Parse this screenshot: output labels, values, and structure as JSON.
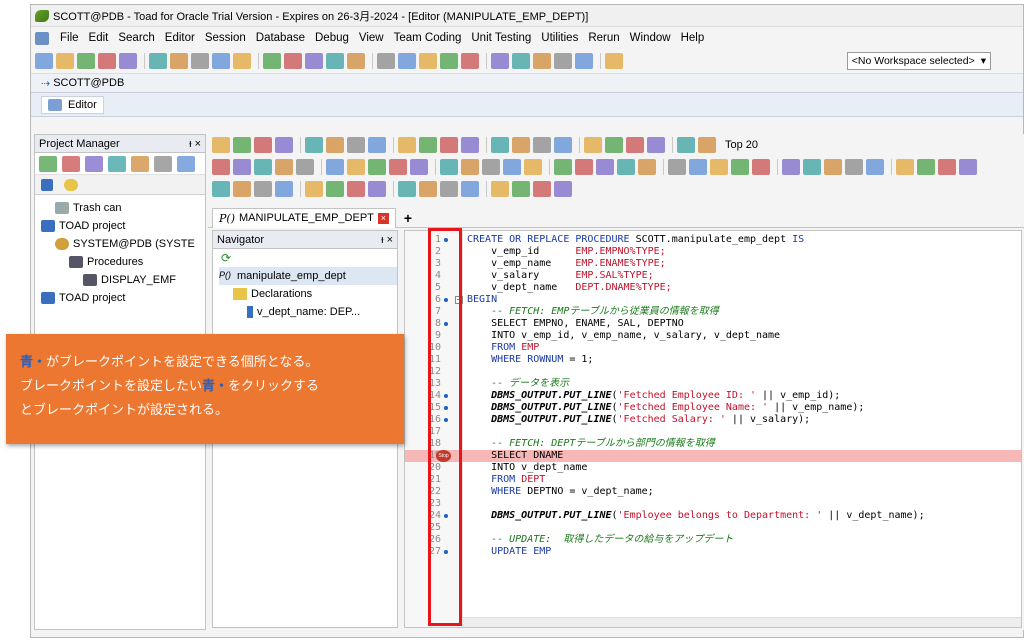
{
  "window": {
    "title": "SCOTT@PDB - Toad for Oracle Trial Version - Expires on 26-3月-2024 - [Editor (MANIPULATE_EMP_DEPT)]"
  },
  "menu": [
    "File",
    "Edit",
    "Search",
    "Editor",
    "Session",
    "Database",
    "Debug",
    "View",
    "Team Coding",
    "Unit Testing",
    "Utilities",
    "Rerun",
    "Window",
    "Help"
  ],
  "workspace": {
    "label": "<No Workspace selected>"
  },
  "connection_tab": {
    "label": "SCOTT@PDB"
  },
  "editor_tab": {
    "label": "Editor"
  },
  "project_manager": {
    "title": "Project Manager",
    "pin": "ᵼ ×",
    "tree": [
      {
        "label": "Trash can",
        "indent": 1,
        "icon": "trash"
      },
      {
        "label": "TOAD project",
        "indent": 0,
        "icon": "project"
      },
      {
        "label": "SYSTEM@PDB (SYSTE",
        "indent": 1,
        "icon": "db"
      },
      {
        "label": "Procedures",
        "indent": 2,
        "icon": "proc"
      },
      {
        "label": "DISPLAY_EMF",
        "indent": 3,
        "icon": "proc"
      },
      {
        "label": "TOAD project",
        "indent": 0,
        "icon": "project"
      }
    ]
  },
  "top_toolbar": {
    "top20": "Top 20"
  },
  "doc_tab": {
    "label": "MANIPULATE_EMP_DEPT",
    "close": "×",
    "add": "+"
  },
  "navigator": {
    "title": "Navigator",
    "pin": "ᵼ ×",
    "items": [
      {
        "label": "manipulate_emp_dept"
      },
      {
        "label": "Declarations"
      },
      {
        "label": "v_dept_name: DEP..."
      }
    ]
  },
  "code": [
    {
      "n": "1",
      "mark": "dot",
      "parts": [
        [
          "kw",
          "CREATE OR REPLACE PROCEDURE "
        ],
        [
          "",
          "SCOTT.manipulate_emp_dept "
        ],
        [
          "kw",
          "IS"
        ]
      ]
    },
    {
      "n": "2",
      "parts": [
        [
          "",
          "    v_emp_id      "
        ],
        [
          "ty",
          "EMP.EMPNO%TYPE;"
        ]
      ]
    },
    {
      "n": "3",
      "parts": [
        [
          "",
          "    v_emp_name    "
        ],
        [
          "ty",
          "EMP.ENAME%TYPE;"
        ]
      ]
    },
    {
      "n": "4",
      "parts": [
        [
          "",
          "    v_salary      "
        ],
        [
          "ty",
          "EMP.SAL%TYPE;"
        ]
      ]
    },
    {
      "n": "5",
      "parts": [
        [
          "",
          "    v_dept_name   "
        ],
        [
          "ty",
          "DEPT.DNAME%TYPE;"
        ]
      ]
    },
    {
      "n": "6",
      "mark": "dot",
      "fold": "−",
      "parts": [
        [
          "kw",
          "BEGIN"
        ]
      ]
    },
    {
      "n": "7",
      "parts": [
        [
          "cm",
          "    -- FETCH: EMPテーブルから従業員の情報を取得"
        ]
      ]
    },
    {
      "n": "8",
      "mark": "dot",
      "parts": [
        [
          "",
          "    SELECT EMPNO, ENAME, SAL, DEPTNO"
        ]
      ]
    },
    {
      "n": "9",
      "parts": [
        [
          "",
          "    INTO v_emp_id, v_emp_name, v_salary, v_dept_name"
        ]
      ]
    },
    {
      "n": "10",
      "parts": [
        [
          "kw",
          "    FROM "
        ],
        [
          "ty",
          "EMP"
        ]
      ]
    },
    {
      "n": "11",
      "parts": [
        [
          "kw",
          "    WHERE "
        ],
        [
          "pn",
          "ROWNUM"
        ],
        [
          "",
          " = 1;"
        ]
      ]
    },
    {
      "n": "12",
      "parts": [
        [
          "",
          ""
        ]
      ]
    },
    {
      "n": "13",
      "parts": [
        [
          "cm",
          "    -- データを表示"
        ]
      ]
    },
    {
      "n": "14",
      "mark": "dot",
      "parts": [
        [
          "fn",
          "    DBMS_OUTPUT.PUT_LINE"
        ],
        [
          "",
          "("
        ],
        [
          "st",
          "'Fetched Employee ID: '"
        ],
        [
          "",
          " || v_emp_id);"
        ]
      ]
    },
    {
      "n": "15",
      "mark": "dot",
      "parts": [
        [
          "fn",
          "    DBMS_OUTPUT.PUT_LINE"
        ],
        [
          "",
          "("
        ],
        [
          "st",
          "'Fetched Employee Name: '"
        ],
        [
          "",
          " || v_emp_name);"
        ]
      ]
    },
    {
      "n": "16",
      "mark": "dot",
      "parts": [
        [
          "fn",
          "    DBMS_OUTPUT.PUT_LINE"
        ],
        [
          "",
          "("
        ],
        [
          "st",
          "'Fetched Salary: '"
        ],
        [
          "",
          " || v_salary);"
        ]
      ]
    },
    {
      "n": "17",
      "parts": [
        [
          "",
          ""
        ]
      ]
    },
    {
      "n": "18",
      "parts": [
        [
          "cm",
          "    -- FETCH: DEPTテーブルから部門の情報を取得"
        ]
      ]
    },
    {
      "n": "19",
      "mark": "stop",
      "highlight": true,
      "parts": [
        [
          "",
          "    SELECT DNAME"
        ]
      ]
    },
    {
      "n": "20",
      "parts": [
        [
          "",
          "    INTO v_dept_name"
        ]
      ]
    },
    {
      "n": "21",
      "parts": [
        [
          "kw",
          "    FROM "
        ],
        [
          "ty",
          "DEPT"
        ]
      ]
    },
    {
      "n": "22",
      "parts": [
        [
          "kw",
          "    WHERE "
        ],
        [
          "",
          "DEPTNO = v_dept_name;"
        ]
      ]
    },
    {
      "n": "23",
      "parts": [
        [
          "",
          ""
        ]
      ]
    },
    {
      "n": "24",
      "mark": "dot",
      "parts": [
        [
          "fn",
          "    DBMS_OUTPUT.PUT_LINE"
        ],
        [
          "",
          "("
        ],
        [
          "st",
          "'Employee belongs to Department: '"
        ],
        [
          "",
          " || v_dept_name);"
        ]
      ]
    },
    {
      "n": "25",
      "parts": [
        [
          "",
          ""
        ]
      ]
    },
    {
      "n": "26",
      "parts": [
        [
          "cm",
          "    -- UPDATE:  取得したデータの給与をアップデート"
        ]
      ]
    },
    {
      "n": "27",
      "mark": "dot",
      "parts": [
        [
          "kw",
          "    UPDATE EMP"
        ]
      ]
    }
  ],
  "stop_label": "Stop",
  "callout": {
    "line1_pre": "青",
    "line1_dot": "・",
    "line1_post": "がブレークポイントを設定できる個所となる。",
    "line2_pre": "ブレークポイントを設定したい",
    "line2_blue": "青",
    "line2_dot": "・",
    "line2_post": "をクリックする",
    "line3": "とブレークポイントが設定される。"
  },
  "colors": {
    "callout": "#ec7731",
    "highlight": "#e8161a",
    "breakpoint_dot": "#1f5fbf"
  }
}
